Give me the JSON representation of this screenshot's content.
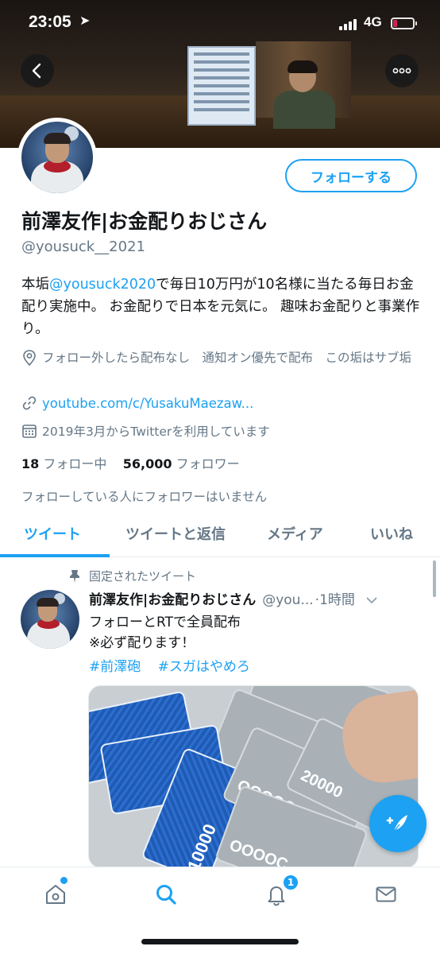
{
  "status_bar": {
    "time": "23:05",
    "network": "4G"
  },
  "header": {
    "follow_label": "フォローする"
  },
  "profile": {
    "display_name": "前澤友作|お金配りおじさん",
    "handle": "@yousuck__2021",
    "bio_prefix": "本垢",
    "bio_mention": "@yousuck2020",
    "bio_suffix": "で毎日10万円が10名様に当たる毎日お金配り実施中。 お金配りで日本を元気に。 趣味お金配りと事業作り。",
    "location": "フォロー外したら配布なし　通知オン優先で配布　この垢はサブ垢",
    "website": "youtube.com/c/YusakuMaezaw...",
    "joined": "2019年3月からTwitterを利用しています",
    "following_count": "18",
    "following_label": "フォロー中",
    "followers_count": "56,000",
    "followers_label": "フォロワー",
    "followed_by_note": "フォローしている人にフォロワーはいません"
  },
  "tabs": [
    {
      "label": "ツイート",
      "active": true
    },
    {
      "label": "ツイートと返信",
      "active": false
    },
    {
      "label": "メディア",
      "active": false
    },
    {
      "label": "いいね",
      "active": false
    }
  ],
  "pinned_tweet": {
    "pinned_label": "固定されたツイート",
    "author_name": "前澤友作|お金配りおじさん",
    "author_handle": "@you...",
    "time": "·1時間",
    "text_line1": "フォローとRTで全員配布",
    "text_line2": "※必ず配ります！",
    "hashtags": [
      "#前澤砲",
      "#スガはやめろ"
    ],
    "media_labels": {
      "blue_note": "10000",
      "gray_note": "20000",
      "gray_code": "OOOOC"
    }
  },
  "bottom_nav": {
    "notification_badge": "1",
    "active_item": "search"
  },
  "colors": {
    "accent": "#1da1f2",
    "text_primary": "#14171a",
    "text_secondary": "#657786",
    "divider": "#e6ecf0"
  },
  "icons": {
    "back": "back-arrow-icon",
    "more": "more-dots-icon",
    "location": "location-pin-icon",
    "link": "link-icon",
    "calendar": "calendar-icon",
    "pin": "pin-icon",
    "compose": "compose-tweet-icon",
    "home": "home-icon",
    "search": "search-icon",
    "notifications": "bell-icon",
    "messages": "mail-icon"
  }
}
